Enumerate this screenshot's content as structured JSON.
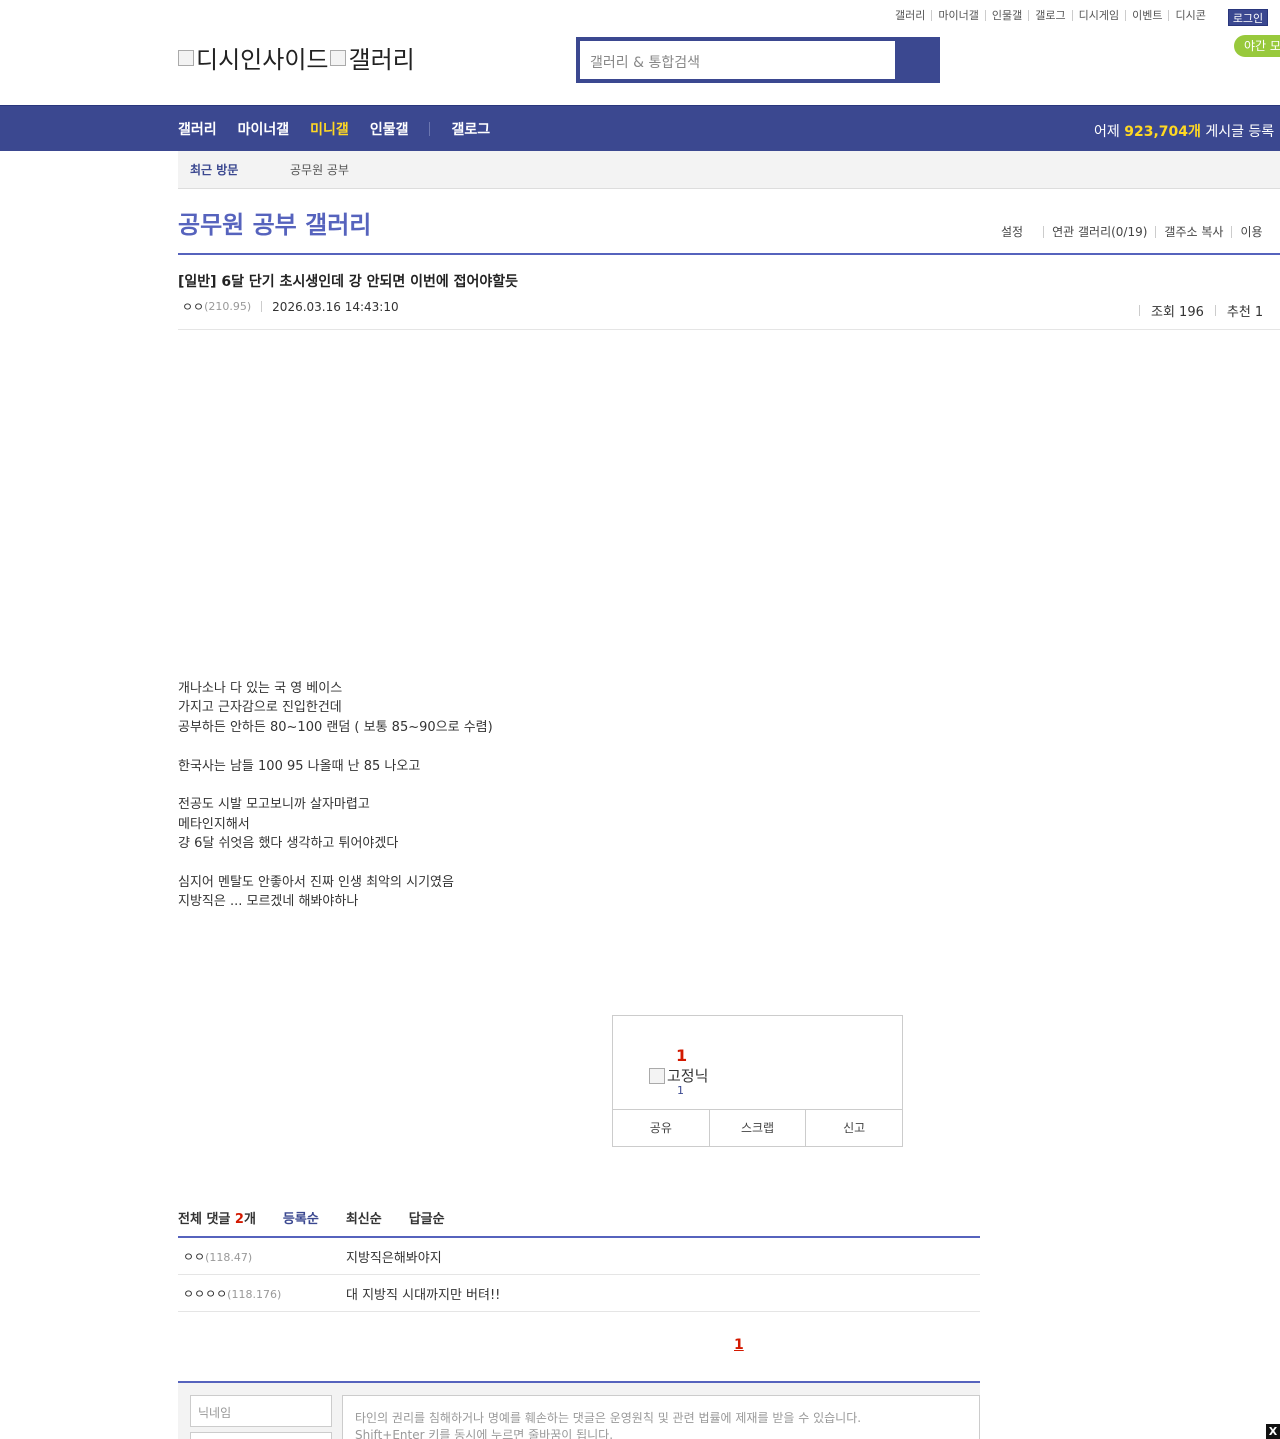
{
  "util_links": [
    "갤러리",
    "마이너갤",
    "인물갤",
    "갤로그",
    "디시게임",
    "이벤트",
    "디시콘"
  ],
  "login_label": "로그인",
  "night_mode_label": "야간 모",
  "logo": {
    "site_alt": "디시인사이드",
    "gallery_alt": "갤러리"
  },
  "search": {
    "placeholder": "갤러리 & 통합검색"
  },
  "gnb": {
    "menu": [
      "갤러리",
      "마이너갤",
      "미니갤",
      "인물갤",
      "갤로그"
    ],
    "active": "미니갤",
    "stat_prefix": "어제",
    "stat_count": "923,704개",
    "stat_suffix": "게시글 등록"
  },
  "recent_visit": {
    "label": "최근 방문",
    "items": [
      "공무원 공부"
    ]
  },
  "gallery": {
    "title": "공무원 공부 갤러리",
    "options": [
      "설정",
      "연관 갤러리(0/19)",
      "갤주소 복사",
      "이용"
    ]
  },
  "post": {
    "title": "[일반] 6달 단기 초시생인데 강 안되면 이번에 접어야할듯",
    "author": "ㅇㅇ",
    "author_ip": "(210.95)",
    "date": "2026.03.16 14:43:10",
    "views_label": "조회 196",
    "recommend_label": "추천 1",
    "body": [
      "개나소나 다 있는 국 영 베이스",
      "가지고 근자감으로 진입한건데",
      "공부하든 안하든 80~100 랜덤 ( 보통 85~90으로 수렴)",
      "",
      "한국사는 남들 100 95 나올때 난 85 나오고",
      "",
      "전공도 시발 모고보니까 살자마렵고",
      "메타인지해서",
      "걍 6달 쉬엇음 했다 생각하고 튀어야겠다",
      "",
      "심지어 멘탈도 안좋아서 진짜 인생 최악의 시기였음",
      "지방직은 ... 모르겠네 해봐야하나"
    ]
  },
  "recommend_box": {
    "count": "1",
    "fixed_nick_alt": "고정닉",
    "fixed_count": "1",
    "actions": [
      "공유",
      "스크랩",
      "신고"
    ]
  },
  "comments": {
    "total_prefix": "전체 댓글",
    "total_count": "2",
    "total_suffix": "개",
    "sorts": [
      "등록순",
      "최신순",
      "답글순"
    ],
    "active_sort": "등록순",
    "items": [
      {
        "nick": "ㅇㅇ",
        "ip": "(118.47)",
        "text": "지방직은해봐야지"
      },
      {
        "nick": "ㅇㅇㅇㅇ",
        "ip": "(118.176)",
        "text": "대 지방직 시대까지만 버텨!!"
      }
    ],
    "page": "1"
  },
  "write": {
    "nick_placeholder": "닉네임",
    "memo_line1": "타인의 권리를 침해하거나 명예를 훼손하는 댓글은 운영원칙 및 관련 법률에 제재를 받을 수 있습니다.",
    "memo_line2": "Shift+Enter 키를 동시에 누르면 줄바꿈이 됩니다."
  },
  "close_label": "X",
  "colors": {
    "brand": "#3b4890",
    "accent": "#5663bd",
    "highlight": "#ffd823",
    "alert": "#d31900",
    "night": "#98c93c"
  }
}
